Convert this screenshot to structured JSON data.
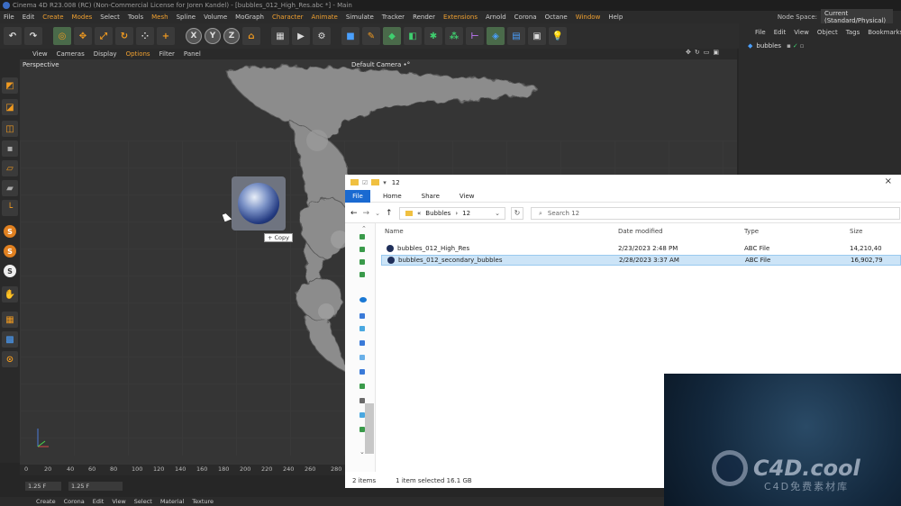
{
  "app": {
    "window_title": "Cinema 4D R23.008 (RC) (Non-Commercial License for Joren Kandel) - [bubbles_012_High_Res.abc *] - Main"
  },
  "menubar": {
    "items": [
      "File",
      "Edit",
      "Create",
      "Modes",
      "Select",
      "Tools",
      "Mesh",
      "Spline",
      "Volume",
      "MoGraph",
      "Character",
      "Animate",
      "Simulate",
      "Tracker",
      "Render",
      "Extensions",
      "Arnold",
      "Corona",
      "Octane",
      "Window",
      "Help"
    ],
    "node_space_label": "Node Space:",
    "node_space_value": "Current (Standard/Physical)"
  },
  "toolbar": {
    "axis_x": "X",
    "axis_y": "Y",
    "axis_z": "Z"
  },
  "viewport": {
    "menu": [
      "View",
      "Cameras",
      "Display",
      "Options",
      "Filter",
      "Panel"
    ],
    "label": "Perspective",
    "camera": "Default Camera •°"
  },
  "timeline": {
    "ticks": [
      "0",
      "20",
      "40",
      "60",
      "80",
      "100",
      "120",
      "140",
      "160",
      "180",
      "200",
      "220",
      "240",
      "260",
      "280"
    ],
    "frame_start": "1.25 F",
    "frame_end": "1.25 F"
  },
  "bottom_menu": [
    "Create",
    "Corona",
    "Edit",
    "View",
    "Select",
    "Material",
    "Texture"
  ],
  "object_manager": {
    "menu": [
      "File",
      "Edit",
      "View",
      "Object",
      "Tags",
      "Bookmarks"
    ],
    "object_name": "bubbles"
  },
  "drag": {
    "tooltip": "+ Copy"
  },
  "explorer": {
    "title": "12",
    "ribbon": {
      "file": "File",
      "tabs": [
        "Home",
        "Share",
        "View"
      ]
    },
    "path": [
      "«",
      "Bubbles",
      "›",
      "12"
    ],
    "search_placeholder": "Search 12",
    "columns": [
      "Name",
      "Date modified",
      "Type",
      "Size"
    ],
    "rows": [
      {
        "name": "bubbles_012_High_Res",
        "date": "2/23/2023 2:48 PM",
        "type": "ABC File",
        "size": "14,210,40"
      },
      {
        "name": "bubbles_012_secondary_bubbles",
        "date": "2/28/2023 3:37 AM",
        "type": "ABC File",
        "size": "16,902,79"
      }
    ],
    "status_items": "2 items",
    "status_selected": "1 item selected  16.1 GB"
  },
  "watermark": {
    "brand": "C4D.cool",
    "sub": "C4D免费素材库"
  }
}
